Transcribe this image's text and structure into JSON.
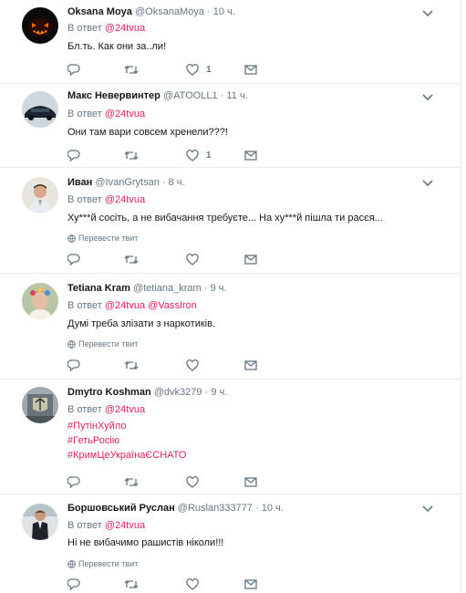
{
  "reply_prefix": "В ответ",
  "translate_label": "Перевести твит",
  "colors": {
    "accent": "#e0245e",
    "secondary": "#657786",
    "divider": "#e6ecf0"
  },
  "tweets": [
    {
      "name": "Oksana Moya",
      "handle": "@OksanaMoya",
      "time": "10 ч.",
      "reply_to": [
        "@24tvua"
      ],
      "text": "Бл.ть. Как они за..ли!",
      "likes": "1",
      "replies": "",
      "retweets": ""
    },
    {
      "name": "Макс Невервинтер",
      "handle": "@ATOOLL1",
      "time": "11 ч.",
      "reply_to": [
        "@24tvua"
      ],
      "text": "Они там   вари совсем    хренели???!",
      "likes": "1",
      "replies": "",
      "retweets": ""
    },
    {
      "name": "Иван",
      "handle": "@IvanGrytsan",
      "time": "8 ч.",
      "reply_to": [
        "@24tvua"
      ],
      "text": "Ху***й сосіть, а не вибачання требуєте... На ху***й пішла ти расєя...",
      "likes": "",
      "replies": "",
      "retweets": ""
    },
    {
      "name": "Tetiana Kram",
      "handle": "@tetiana_kram",
      "time": "9 ч.",
      "reply_to": [
        "@24tvua",
        "@VassIron"
      ],
      "text": "Думі треба злізати з наркотиків.",
      "likes": "",
      "replies": "",
      "retweets": ""
    },
    {
      "name": "Dmytro Koshman",
      "handle": "@dvk3279",
      "time": "9 ч.",
      "reply_to": [
        "@24tvua"
      ],
      "hashtags": [
        "#ПутінХуйло",
        "#ГетьРосію",
        "#КримЦеУкраїнаЄСНАТО"
      ],
      "likes": "",
      "replies": "",
      "retweets": ""
    },
    {
      "name": "Боршовський Руслан",
      "handle": "@Ruslan333777",
      "time": "10 ч.",
      "reply_to": [
        "@24tvua"
      ],
      "text": "Ні не вибачимо рашистів ніколи!!!",
      "likes": "",
      "replies": "",
      "retweets": ""
    }
  ]
}
